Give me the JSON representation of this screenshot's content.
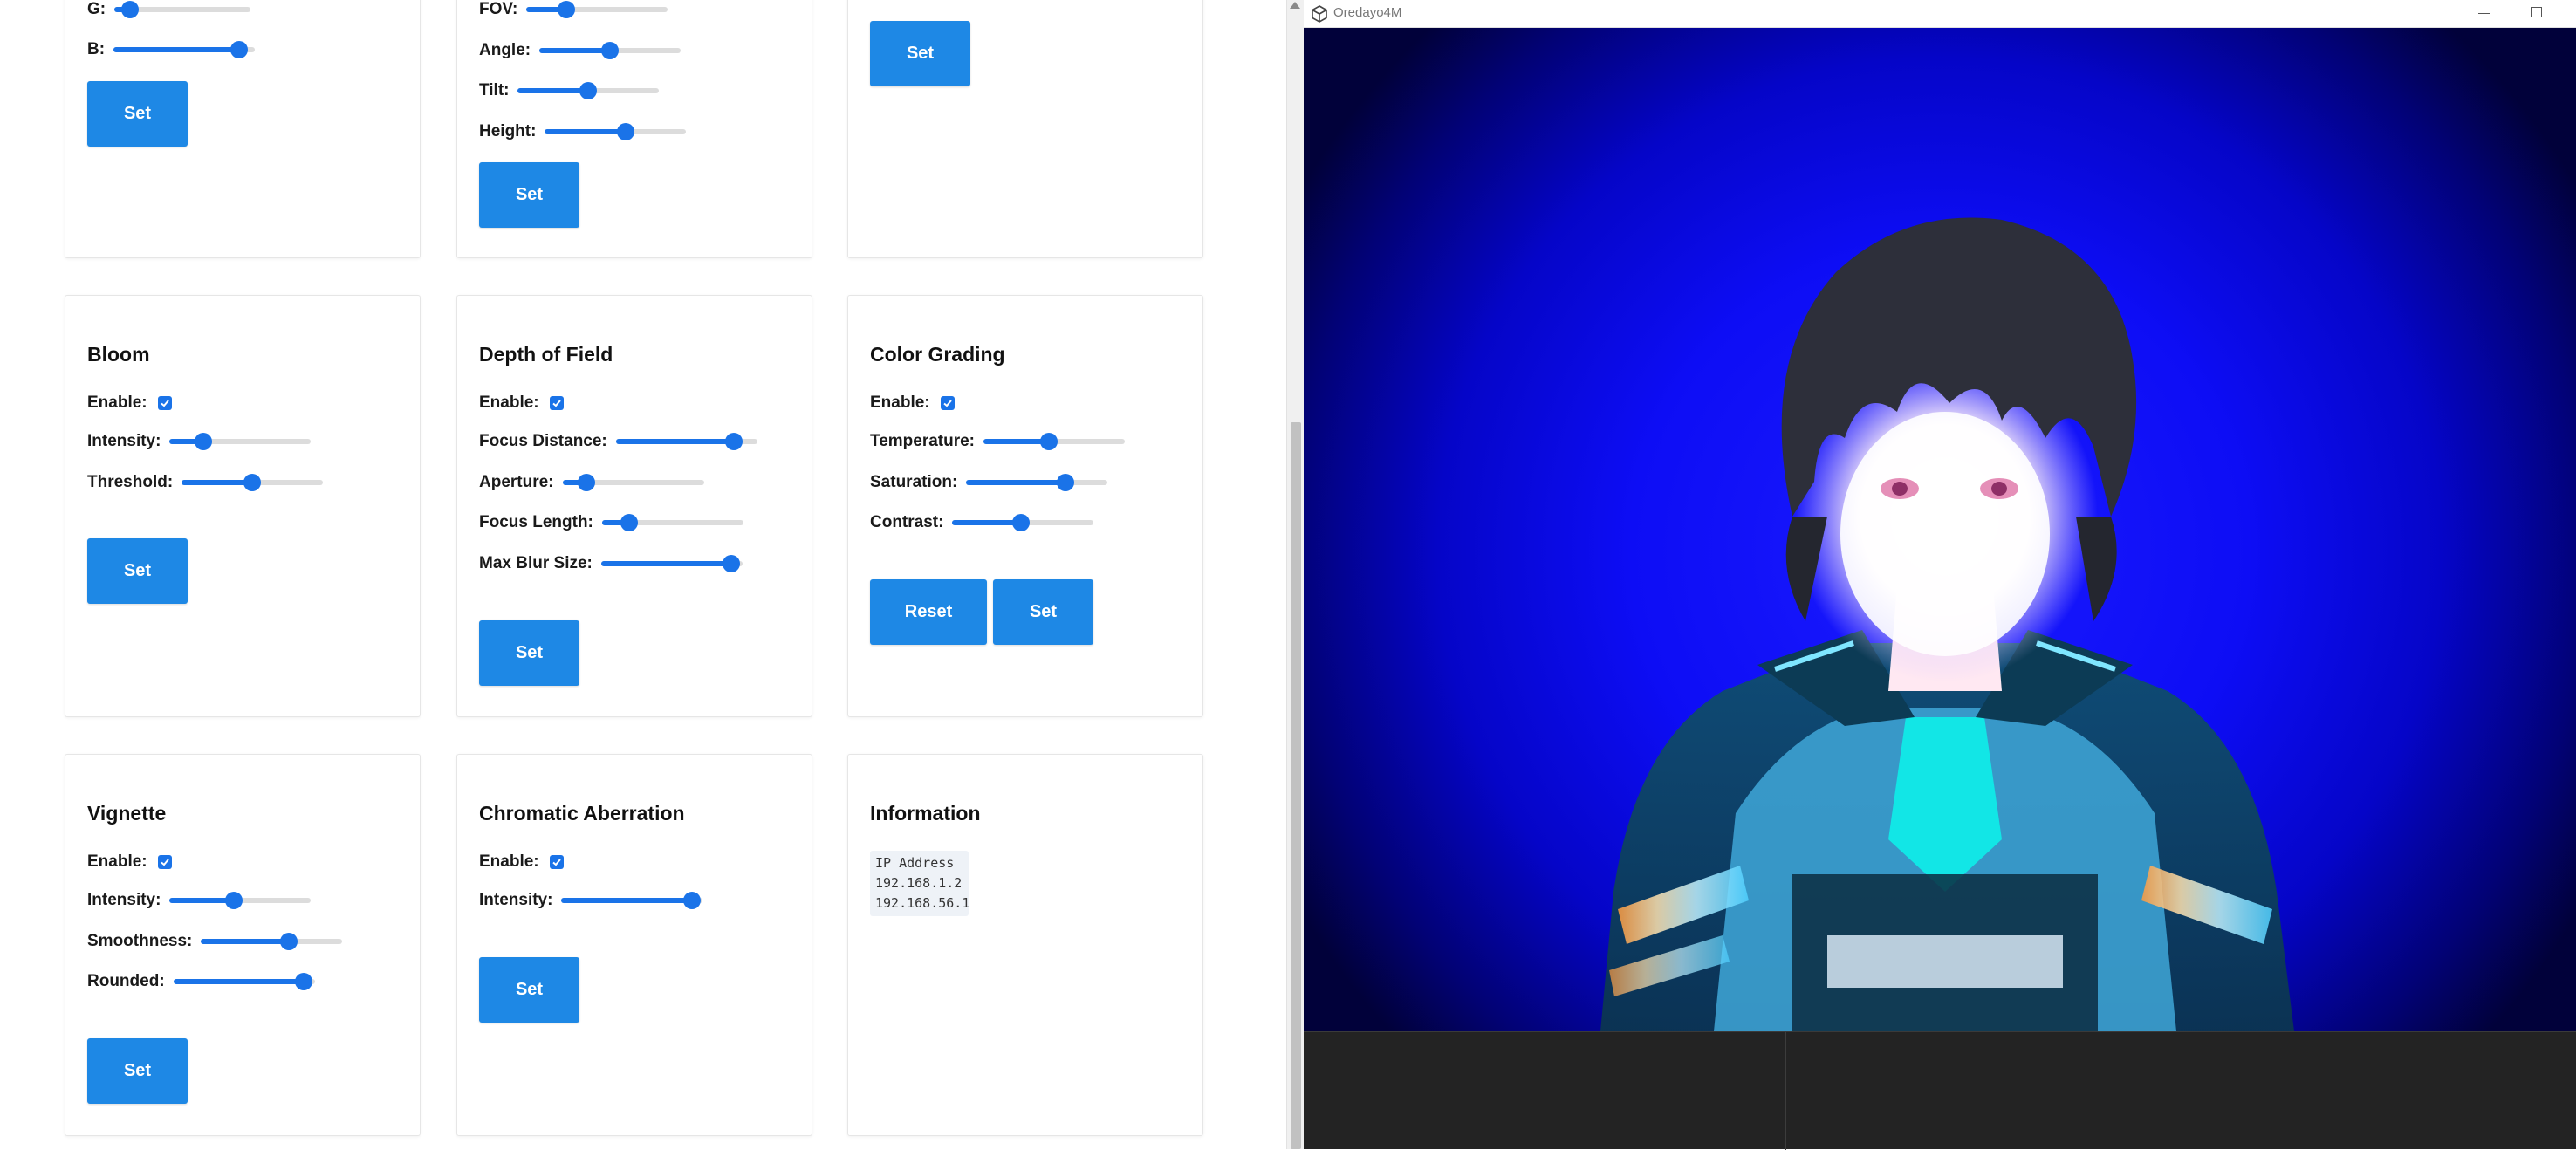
{
  "cards": {
    "color": {
      "sliders": [
        {
          "label": "G:",
          "value": 0.06
        },
        {
          "label": "B:",
          "value": 0.94
        }
      ],
      "set_label": "Set"
    },
    "camera": {
      "sliders": [
        {
          "label": "FOV:",
          "value": 0.25
        },
        {
          "label": "Angle:",
          "value": 0.5
        },
        {
          "label": "Tilt:",
          "value": 0.5
        },
        {
          "label": "Height:",
          "value": 0.58
        }
      ],
      "set_label": "Set"
    },
    "top_right": {
      "set_label": "Set"
    },
    "bloom": {
      "title": "Bloom",
      "enable_label": "Enable:",
      "enabled": true,
      "sliders": [
        {
          "label": "Intensity:",
          "value": 0.2
        },
        {
          "label": "Threshold:",
          "value": 0.5
        }
      ],
      "set_label": "Set"
    },
    "depth_of_field": {
      "title": "Depth of Field",
      "enable_label": "Enable:",
      "enabled": true,
      "sliders": [
        {
          "label": "Focus Distance:",
          "value": 0.88
        },
        {
          "label": "Aperture:",
          "value": 0.12
        },
        {
          "label": "Focus Length:",
          "value": 0.15
        },
        {
          "label": "Max Blur Size:",
          "value": 0.98
        }
      ],
      "set_label": "Set"
    },
    "color_grading": {
      "title": "Color Grading",
      "enable_label": "Enable:",
      "enabled": true,
      "sliders": [
        {
          "label": "Temperature:",
          "value": 0.46
        },
        {
          "label": "Saturation:",
          "value": 0.73
        },
        {
          "label": "Contrast:",
          "value": 0.48
        }
      ],
      "reset_label": "Reset",
      "set_label": "Set"
    },
    "vignette": {
      "title": "Vignette",
      "enable_label": "Enable:",
      "enabled": true,
      "sliders": [
        {
          "label": "Intensity:",
          "value": 0.45
        },
        {
          "label": "Smoothness:",
          "value": 0.64
        },
        {
          "label": "Rounded:",
          "value": 0.98
        }
      ],
      "set_label": "Set"
    },
    "chromatic_aberration": {
      "title": "Chromatic Aberration",
      "enable_label": "Enable:",
      "enabled": true,
      "sliders": [
        {
          "label": "Intensity:",
          "value": 0.98
        }
      ],
      "set_label": "Set"
    },
    "information": {
      "title": "Information",
      "lines": [
        "IP Address",
        "192.168.1.2",
        "192.168.56.1"
      ]
    }
  },
  "unity_window": {
    "title": "Oredayo4M",
    "background_color": "#0d0df5"
  }
}
